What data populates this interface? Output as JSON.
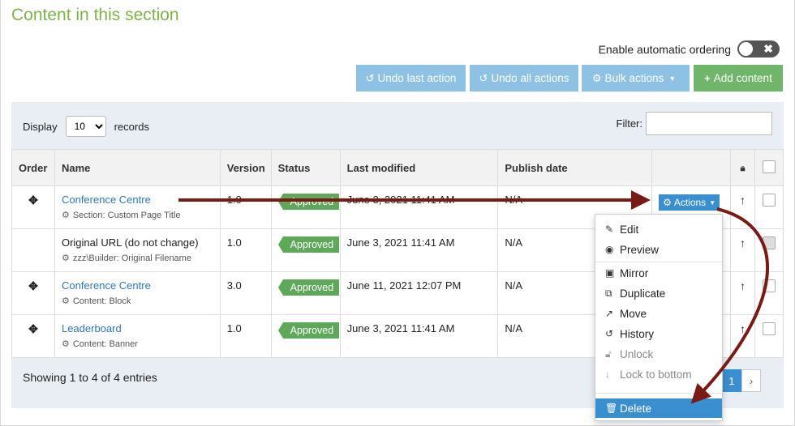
{
  "section_title": "Content in this section",
  "auto_ordering": {
    "label": "Enable automatic ordering",
    "toggle_symbol": "✖"
  },
  "toolbar": {
    "undo_last": "Undo last action",
    "undo_all": "Undo all actions",
    "bulk": "Bulk actions",
    "add": "Add content"
  },
  "controls": {
    "display_label": "Display",
    "display_value": "10",
    "records_label": "records",
    "filter_label": "Filter:"
  },
  "table": {
    "headers": [
      "Order",
      "Name",
      "Version",
      "Status",
      "Last modified",
      "Publish date"
    ],
    "rows": [
      {
        "name": "Conference Centre",
        "sub": "Section: Custom Page Title",
        "version": "1.0",
        "status": "Approved",
        "modified": "June 3, 2021 11:41 AM",
        "publish": "N/A"
      },
      {
        "name": "Original URL (do not change)",
        "sub": "zzz\\Builder: Original Filename",
        "version": "1.0",
        "status": "Approved",
        "modified": "June 3, 2021 11:41 AM",
        "publish": "N/A"
      },
      {
        "name": "Conference Centre",
        "sub": "Content: Block",
        "version": "3.0",
        "status": "Approved",
        "modified": "June 11, 2021 12:07 PM",
        "publish": "N/A"
      },
      {
        "name": "Leaderboard",
        "sub": "Content: Banner",
        "version": "1.0",
        "status": "Approved",
        "modified": "June 3, 2021 11:41 AM",
        "publish": "N/A"
      }
    ],
    "actions_label": "Actions"
  },
  "footer": {
    "info": "Showing 1 to 4 of 4 entries",
    "page": "1",
    "next": "›"
  },
  "dropdown": {
    "items": [
      "Edit",
      "Preview",
      "Mirror",
      "Duplicate",
      "Move",
      "History",
      "Unlock",
      "Lock to bottom",
      "Delete"
    ]
  },
  "colors": {
    "accent": "#3a8fd0",
    "success": "#5fa85a",
    "title": "#7bb542",
    "annotation": "#7a1a14"
  }
}
